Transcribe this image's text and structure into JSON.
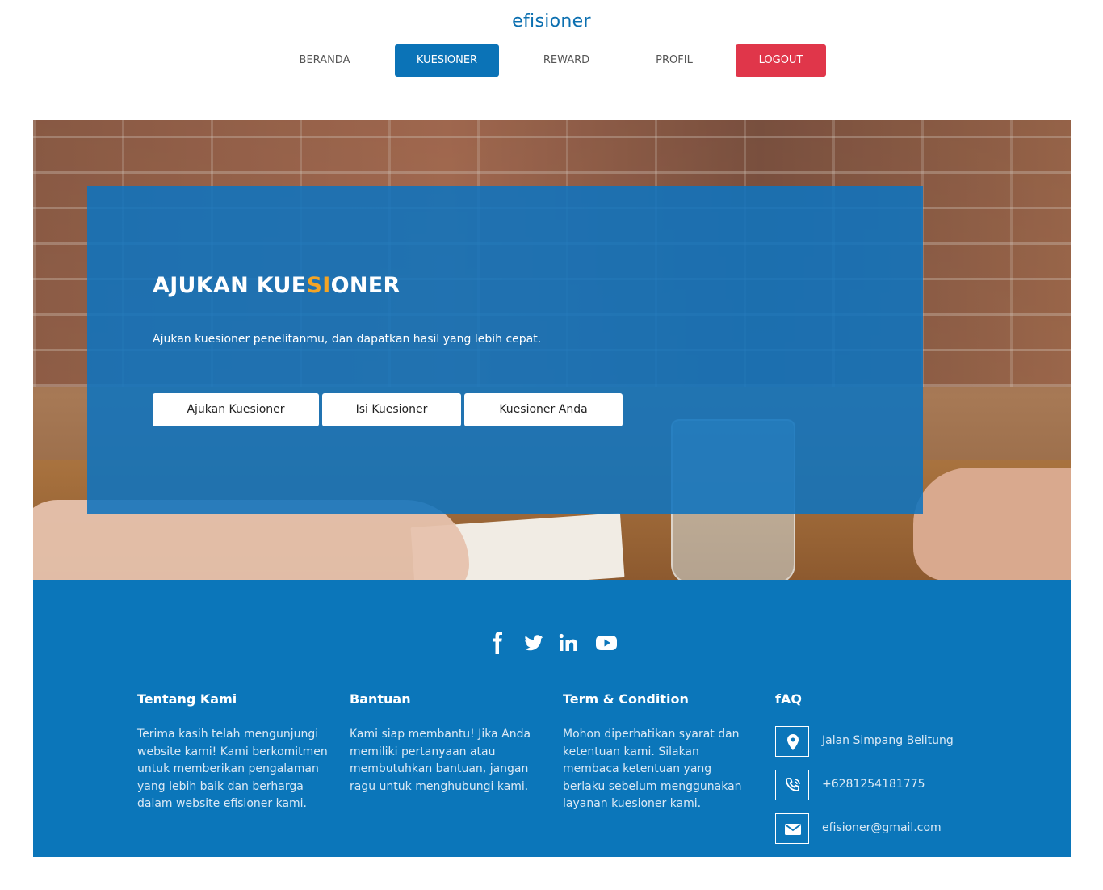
{
  "brand": "efisioner",
  "nav": [
    {
      "label": "BERANDA",
      "state": "default"
    },
    {
      "label": "KUESIONER",
      "state": "active"
    },
    {
      "label": "REWARD",
      "state": "default"
    },
    {
      "label": "PROFIL",
      "state": "default"
    },
    {
      "label": "LOGOUT",
      "state": "danger"
    }
  ],
  "hero": {
    "title_parts": [
      "AJUKAN KUE",
      "SI",
      "ONER"
    ],
    "description": "Ajukan kuesioner penelitanmu, dan dapatkan hasil yang lebih cepat.",
    "buttons": [
      "Ajukan Kuesioner",
      "Isi Kuesioner",
      "Kuesioner Anda"
    ]
  },
  "footer": {
    "social_icons": [
      "facebook-icon",
      "twitter-icon",
      "linkedin-icon",
      "youtube-icon"
    ],
    "columns": [
      {
        "title": "Tentang Kami",
        "text": "Terima kasih telah mengunjungi website kami! Kami berkomitmen untuk memberikan pengalaman yang lebih baik dan berharga dalam website efisioner kami."
      },
      {
        "title": "Bantuan",
        "text": "Kami siap membantu! Jika Anda memiliki pertanyaan atau membutuhkan bantuan, jangan ragu untuk menghubungi kami."
      },
      {
        "title": "Term & Condition",
        "text": "Mohon diperhatikan syarat dan ketentuan kami. Silakan membaca ketentuan yang berlaku sebelum menggunakan layanan kuesioner kami."
      },
      {
        "title": "fAQ"
      }
    ],
    "contacts": [
      {
        "icon": "location-icon",
        "text": "Jalan Simpang Belitung"
      },
      {
        "icon": "phone-icon",
        "text": "+6281254181775"
      },
      {
        "icon": "email-icon",
        "text": "efisioner@gmail.com"
      }
    ]
  },
  "colors": {
    "primary": "#0b73b7",
    "danger": "#e0364a",
    "accent": "#f4a425"
  }
}
